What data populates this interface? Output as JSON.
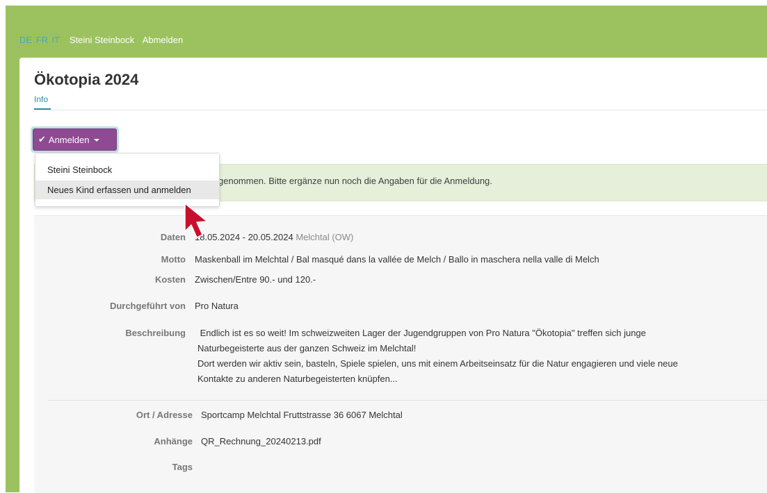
{
  "topnav": {
    "languages": [
      "DE",
      "FR",
      "IT"
    ],
    "user": "Steini Steinbock",
    "logout": "Abmelden"
  },
  "page": {
    "title": "Ökotopia 2024",
    "tab": "Info"
  },
  "register_button": {
    "label": "Anmelden",
    "icon": "check-icon"
  },
  "dropdown": {
    "items": [
      "Steini Steinbock",
      "Neues Kind erfassen und anmelden"
    ]
  },
  "alert": {
    "text": "genommen. Bitte ergänze nun noch die Angaben für die Anmeldung."
  },
  "details": {
    "daten": {
      "label": "Daten",
      "dates": "18.05.2024 - 20.05.2024",
      "place": "Melchtal (OW)"
    },
    "motto": {
      "label": "Motto",
      "value": "Maskenball im Melchtal / Bal masqué dans la vallée de Melch / Ballo in maschera nella valle di Melch"
    },
    "kosten": {
      "label": "Kosten",
      "value": "Zwischen/Entre 90.- und 120.-"
    },
    "durchgefuehrt": {
      "label": "Durchgeführt von",
      "value": "Pro Natura"
    },
    "beschreibung": {
      "label": "Beschreibung",
      "lines": [
        " Endlich ist es so weit! Im schweizweiten Lager der Jugendgruppen von Pro Natura \"Ökotopia\" treffen sich junge",
        "Naturbegeisterte aus der ganzen Schweiz im Melchtal!",
        "Dort werden wir aktiv sein, basteln, Spiele spielen, uns mit einem Arbeitseinsatz für die Natur engagieren und viele neue",
        "Kontakte zu anderen Naturbegeisterten knüpfen..."
      ]
    },
    "ort": {
      "label": "Ort / Adresse",
      "value": "Sportcamp Melchtal Fruttstrasse 36 6067 Melchtal"
    },
    "anhaenge": {
      "label": "Anhänge",
      "value": "QR_Rechnung_20240213.pdf"
    },
    "tags": {
      "label": "Tags",
      "value": ""
    }
  },
  "colors": {
    "accent_green": "#9bc25f",
    "button_purple": "#8e4a93",
    "link_teal": "#2a8ea8",
    "alert_green": "#e5efd9",
    "cursor_red": "#c8102e"
  },
  "cursor": {
    "icon": "mouse-pointer-icon"
  }
}
